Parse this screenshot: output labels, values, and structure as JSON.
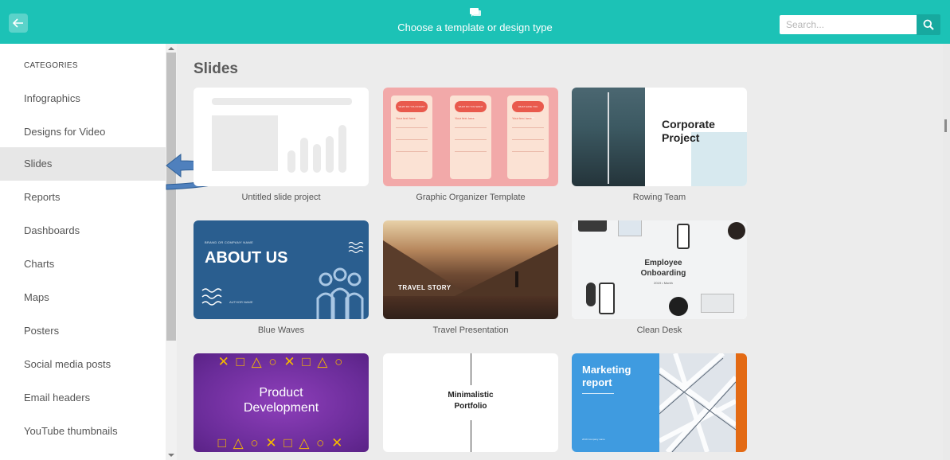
{
  "header": {
    "back_icon": "arrow-left-icon",
    "title_icon": "chat-icon",
    "title": "Choose a template or design type",
    "search_placeholder": "Search...",
    "search_icon": "search-icon",
    "accent_color": "#1cc2b6"
  },
  "sidebar": {
    "heading": "CATEGORIES",
    "items": [
      {
        "label": "Infographics",
        "active": false
      },
      {
        "label": "Designs for Video",
        "active": false
      },
      {
        "label": "Slides",
        "active": true
      },
      {
        "label": "Reports",
        "active": false
      },
      {
        "label": "Dashboards",
        "active": false
      },
      {
        "label": "Charts",
        "active": false
      },
      {
        "label": "Maps",
        "active": false
      },
      {
        "label": "Posters",
        "active": false
      },
      {
        "label": "Social media posts",
        "active": false
      },
      {
        "label": "Email headers",
        "active": false
      },
      {
        "label": "YouTube thumbnails",
        "active": false
      }
    ]
  },
  "main": {
    "section_title": "Slides",
    "cards": [
      {
        "label": "Untitled slide project"
      },
      {
        "label": "Graphic Organizer Template",
        "thumb": {
          "pills": [
            "WHAT DO YOU KNOW?",
            "WHAT DO YOU WANT KNOW?",
            "WHAT HAVE YOU LEARNED?"
          ],
          "placeholder": "Your text here"
        }
      },
      {
        "label": "Rowing Team",
        "thumb": {
          "title_line1": "Corporate",
          "title_line2": "Project"
        }
      },
      {
        "label": "Blue Waves",
        "thumb": {
          "small_text": "BRAND OR COMPANY NAME",
          "title": "ABOUT US",
          "footer": "AUTHOR NAME"
        }
      },
      {
        "label": "Travel Presentation",
        "thumb": {
          "title": "TRAVEL STORY"
        }
      },
      {
        "label": "Clean Desk",
        "thumb": {
          "title_line1": "Employee",
          "title_line2": "Onboarding",
          "subtitle": "2019 • Month"
        }
      },
      {
        "label": "",
        "thumb": {
          "symbols_top": "✕ □ △ ○ ✕ □ △ ○",
          "title_line1": "Product",
          "title_line2": "Development",
          "symbols_bottom": "□ △ ○ ✕ □ △ ○ ✕"
        }
      },
      {
        "label": "",
        "thumb": {
          "title_line1": "Minimalistic",
          "title_line2": "Portfolio"
        }
      },
      {
        "label": "",
        "thumb": {
          "title_line1": "Marketing",
          "title_line2": "report",
          "footer": "2019 Company name"
        }
      }
    ]
  }
}
